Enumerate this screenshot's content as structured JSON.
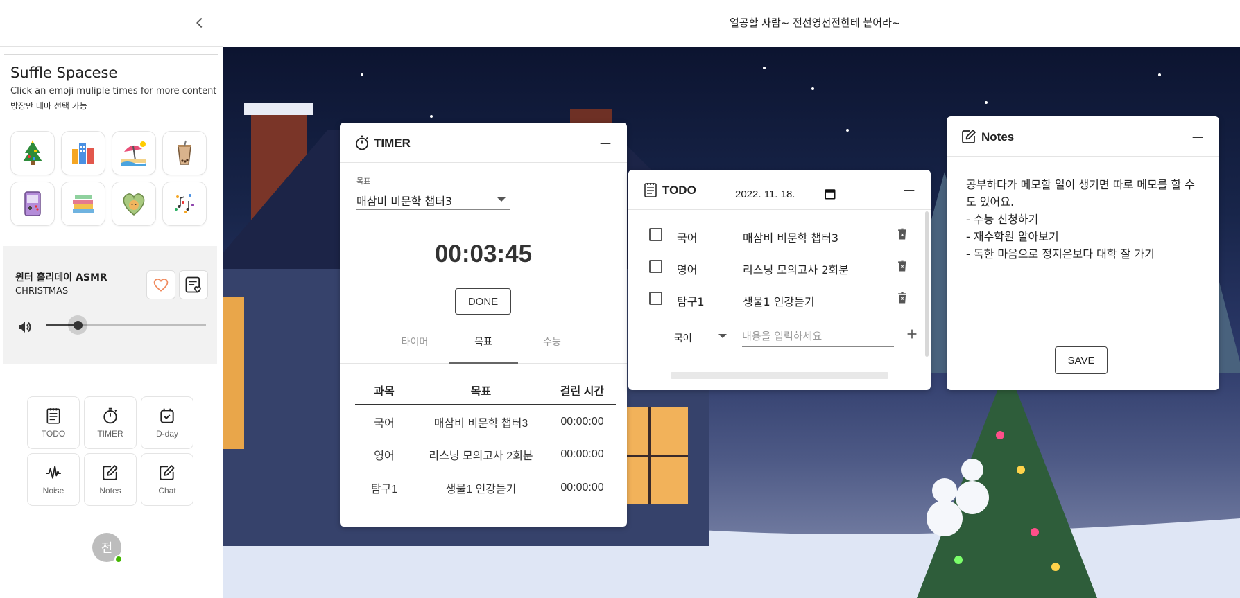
{
  "sidebar": {
    "title": "Suffle Spacese",
    "subtitle": "Click an emoji muliple times for more content",
    "subtitle2": "방장만 테마 선택 가능",
    "emojis": [
      "christmas-tree-icon",
      "city-buildings-icon",
      "beach-umbrella-icon",
      "bubble-tea-icon",
      "game-console-icon",
      "books-icon",
      "heart-cat-icon",
      "music-notes-icon"
    ],
    "player": {
      "title": "윈터 홀리데이 ASMR",
      "subtitle": "CHRISTMAS",
      "volume": 0.2
    },
    "tools": [
      {
        "label": "TODO",
        "icon": "todo-list-icon"
      },
      {
        "label": "TIMER",
        "icon": "stopwatch-icon"
      },
      {
        "label": "D-day",
        "icon": "calendar-check-icon"
      },
      {
        "label": "Noise",
        "icon": "waveform-icon"
      },
      {
        "label": "Notes",
        "icon": "edit-note-icon"
      },
      {
        "label": "Chat",
        "icon": "chat-edit-icon"
      }
    ],
    "avatar_initial": "전"
  },
  "topbar": {
    "message": "열공할 사람~ 전선영선전한테 붙어라~"
  },
  "timer": {
    "title": "TIMER",
    "goal_label": "목표",
    "goal_value": "매삼비 비문학 챕터3",
    "time": "00:03:45",
    "done_label": "DONE",
    "tabs": [
      "타이머",
      "목표",
      "수능"
    ],
    "active_tab": 1,
    "table": {
      "headers": [
        "과목",
        "목표",
        "걸린 시간"
      ],
      "rows": [
        [
          "국어",
          "매삼비 비문학 챕터3",
          "00:00:00"
        ],
        [
          "영어",
          "리스닝 모의고사 2회분",
          "00:00:00"
        ],
        [
          "탐구1",
          "생물1 인강듣기",
          "00:00:00"
        ]
      ]
    }
  },
  "todo": {
    "title": "TODO",
    "date": "2022. 11. 18.",
    "items": [
      {
        "subject": "국어",
        "task": "매삼비 비문학 챕터3",
        "done": false
      },
      {
        "subject": "영어",
        "task": "리스닝 모의고사 2회분",
        "done": false
      },
      {
        "subject": "탐구1",
        "task": "생물1 인강듣기",
        "done": false
      }
    ],
    "new_subject": "국어",
    "new_placeholder": "내용을 입력하세요"
  },
  "notes": {
    "title": "Notes",
    "lines": [
      "공부하다가 메모할 일이 생기면 따로 메모를 할 수도 있어요.",
      "- 수능 신청하기",
      "- 재수학원 알아보기",
      "- 독한 마음으로 정지은보다 대학 잘 가기"
    ],
    "save_label": "SAVE"
  }
}
